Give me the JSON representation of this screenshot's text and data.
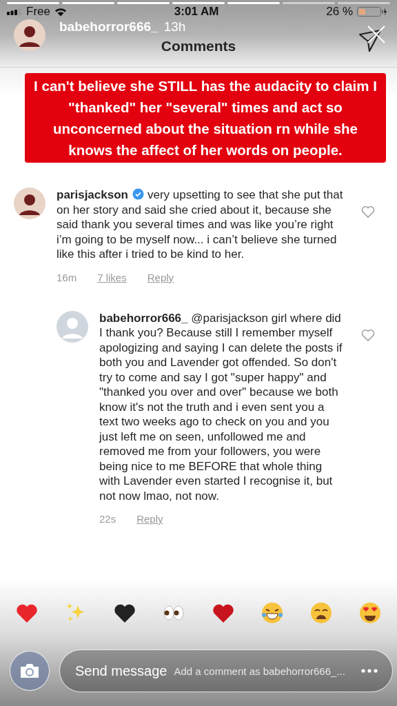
{
  "status_bar": {
    "carrier": "Free",
    "time": "3:01 AM",
    "battery": "26 %"
  },
  "story": {
    "username": "babehorror666_",
    "time": "13h",
    "caption": "I can't believe she STILL has the audacity to claim I \"thanked\" her \"several\" times and act so unconcerned about the situation rn while she knows the affect of her words on people."
  },
  "comments_header": {
    "title": "Comments"
  },
  "comments": [
    {
      "kind": "comment",
      "username": "parisjackson",
      "verified": true,
      "text": "very upsetting to see that she put that on her story and said she cried about it, because she said thank you several times and was like you’re right i’m going to be myself now... i can’t believe she turned like this after i tried to be kind to her.",
      "time": "16m",
      "likes": "7 likes",
      "reply": "Reply",
      "liked": false
    },
    {
      "kind": "reply",
      "username": "babehorror666_",
      "verified": false,
      "mention": "@parisjackson",
      "text": "girl where did I thank you? Because still I remember myself apologizing and saying I can delete the posts if both you and Lavender got offended. So don't try to come and say I got \"super happy\" and \"thanked you over and over\" because we both know it's not the truth and i even sent you a text two weeks ago to check on you and you just left me on seen, unfollowed me and removed me from your followers, you were being nice to me BEFORE that whole thing with Lavender even started I recognise it, but not now lmao, not now.",
      "time": "22s",
      "reply": "Reply",
      "liked": false
    }
  ],
  "composer": {
    "placeholder": "Add a comment as babehorror666_...",
    "story_reply": "Send message"
  }
}
